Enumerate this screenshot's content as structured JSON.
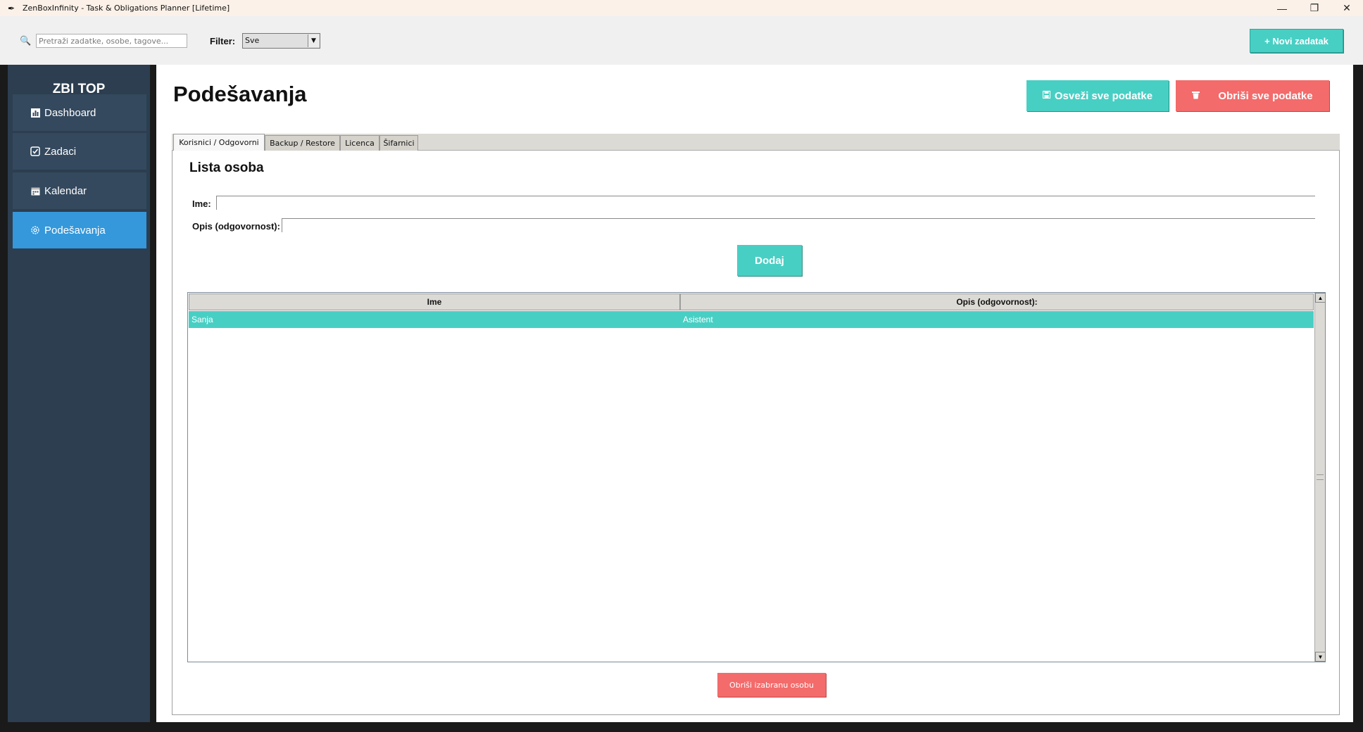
{
  "window": {
    "title": "ZenBoxInfinity - Task & Obligations Planner [Lifetime]",
    "controls": {
      "minimize": "—",
      "maximize": "❐",
      "close": "✕"
    }
  },
  "toolbar": {
    "search_placeholder": "Pretraži zadatke, osobe, tagove...",
    "search_icon": "search-icon",
    "filter_label": "Filter:",
    "filter_value": "Sve",
    "new_task_label": "+ Novi zadatak"
  },
  "sidebar": {
    "brand": "ZBI TOP",
    "items": [
      {
        "label": "Dashboard",
        "icon": "chart-icon",
        "active": false
      },
      {
        "label": "Zadaci",
        "icon": "checkbox-icon",
        "active": false
      },
      {
        "label": "Kalendar",
        "icon": "calendar-icon",
        "active": false
      },
      {
        "label": "Podešavanja",
        "icon": "gear-icon",
        "active": true
      }
    ]
  },
  "main": {
    "page_title": "Podešavanja",
    "refresh_label": "Osveži sve podatke",
    "delete_all_label": "Obriši sve podatke",
    "tabs": [
      {
        "label": "Korisnici / Odgovorni",
        "active": true
      },
      {
        "label": "Backup / Restore",
        "active": false
      },
      {
        "label": "Licenca",
        "active": false
      },
      {
        "label": "Šifarnici",
        "active": false
      }
    ],
    "section_title": "Lista osoba",
    "form": {
      "name_label": "Ime:",
      "name_value": "",
      "desc_label": "Opis (odgovornost):",
      "desc_value": "",
      "add_label": "Dodaj"
    },
    "table": {
      "columns": [
        "Ime",
        "Opis (odgovornost):"
      ],
      "rows": [
        {
          "name": "Sanja",
          "desc": "Asistent",
          "selected": true
        }
      ]
    },
    "delete_person_label": "Obriši izabranu osobu"
  },
  "colors": {
    "accent": "#48cfc4",
    "danger": "#f36b6b",
    "sidebar_bg": "#2c3e50",
    "sidebar_item": "#34495e",
    "sidebar_active": "#3498db"
  }
}
